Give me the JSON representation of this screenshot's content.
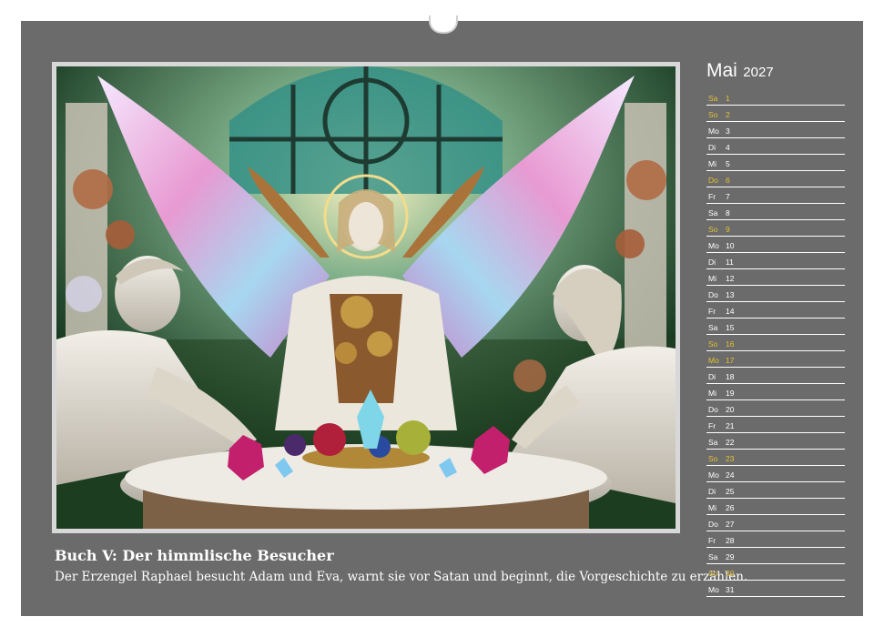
{
  "calendar": {
    "month": "Mai",
    "year": "2027",
    "caption_title": "Buch V: Der himmlische Besucher",
    "caption_text": "Der Erzengel Raphael besucht Adam und Eva, warnt sie vor Satan und beginnt, die Vorgeschichte zu erzählen.",
    "accent_color": "#e3c12e",
    "background_color": "#6b6b6b",
    "days": [
      {
        "wd": "Sa",
        "d": "1",
        "weekend": true
      },
      {
        "wd": "So",
        "d": "2",
        "weekend": true
      },
      {
        "wd": "Mo",
        "d": "3",
        "weekend": false
      },
      {
        "wd": "Di",
        "d": "4",
        "weekend": false
      },
      {
        "wd": "Mi",
        "d": "5",
        "weekend": false
      },
      {
        "wd": "Do",
        "d": "6",
        "weekend": true
      },
      {
        "wd": "Fr",
        "d": "7",
        "weekend": false
      },
      {
        "wd": "Sa",
        "d": "8",
        "weekend": false
      },
      {
        "wd": "So",
        "d": "9",
        "weekend": true
      },
      {
        "wd": "Mo",
        "d": "10",
        "weekend": false
      },
      {
        "wd": "Di",
        "d": "11",
        "weekend": false
      },
      {
        "wd": "Mi",
        "d": "12",
        "weekend": false
      },
      {
        "wd": "Do",
        "d": "13",
        "weekend": false
      },
      {
        "wd": "Fr",
        "d": "14",
        "weekend": false
      },
      {
        "wd": "Sa",
        "d": "15",
        "weekend": false
      },
      {
        "wd": "So",
        "d": "16",
        "weekend": true
      },
      {
        "wd": "Mo",
        "d": "17",
        "weekend": true
      },
      {
        "wd": "Di",
        "d": "18",
        "weekend": false
      },
      {
        "wd": "Mi",
        "d": "19",
        "weekend": false
      },
      {
        "wd": "Do",
        "d": "20",
        "weekend": false
      },
      {
        "wd": "Fr",
        "d": "21",
        "weekend": false
      },
      {
        "wd": "Sa",
        "d": "22",
        "weekend": false
      },
      {
        "wd": "So",
        "d": "23",
        "weekend": true
      },
      {
        "wd": "Mo",
        "d": "24",
        "weekend": false
      },
      {
        "wd": "Di",
        "d": "25",
        "weekend": false
      },
      {
        "wd": "Mi",
        "d": "26",
        "weekend": false
      },
      {
        "wd": "Do",
        "d": "27",
        "weekend": false
      },
      {
        "wd": "Fr",
        "d": "28",
        "weekend": false
      },
      {
        "wd": "Sa",
        "d": "29",
        "weekend": false
      },
      {
        "wd": "So",
        "d": "30",
        "weekend": true
      },
      {
        "wd": "Mo",
        "d": "31",
        "weekend": false
      }
    ]
  }
}
